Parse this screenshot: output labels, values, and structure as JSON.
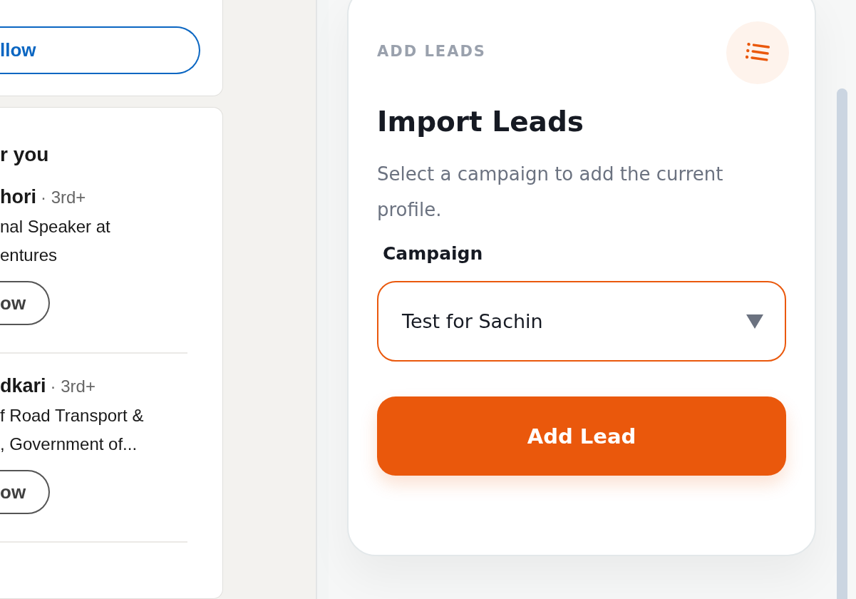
{
  "feed_sidebar": {
    "top_card": {
      "button": "llow"
    },
    "suggestions": {
      "heading": "r you",
      "people": [
        {
          "name": "hori",
          "degree": "· 3rd+",
          "headline": "nal Speaker at\nentures",
          "button": "ow"
        },
        {
          "name": "dkari",
          "degree": "· 3rd+",
          "headline": "f Road Transport &\n, Government of...",
          "button": "ow"
        }
      ]
    }
  },
  "panel": {
    "eyebrow": "ADD LEADS",
    "title": "Import Leads",
    "description": "Select a campaign to add the current profile.",
    "field": {
      "label": "Campaign",
      "value": "Test for Sachin"
    },
    "button": "Add Lead"
  }
}
